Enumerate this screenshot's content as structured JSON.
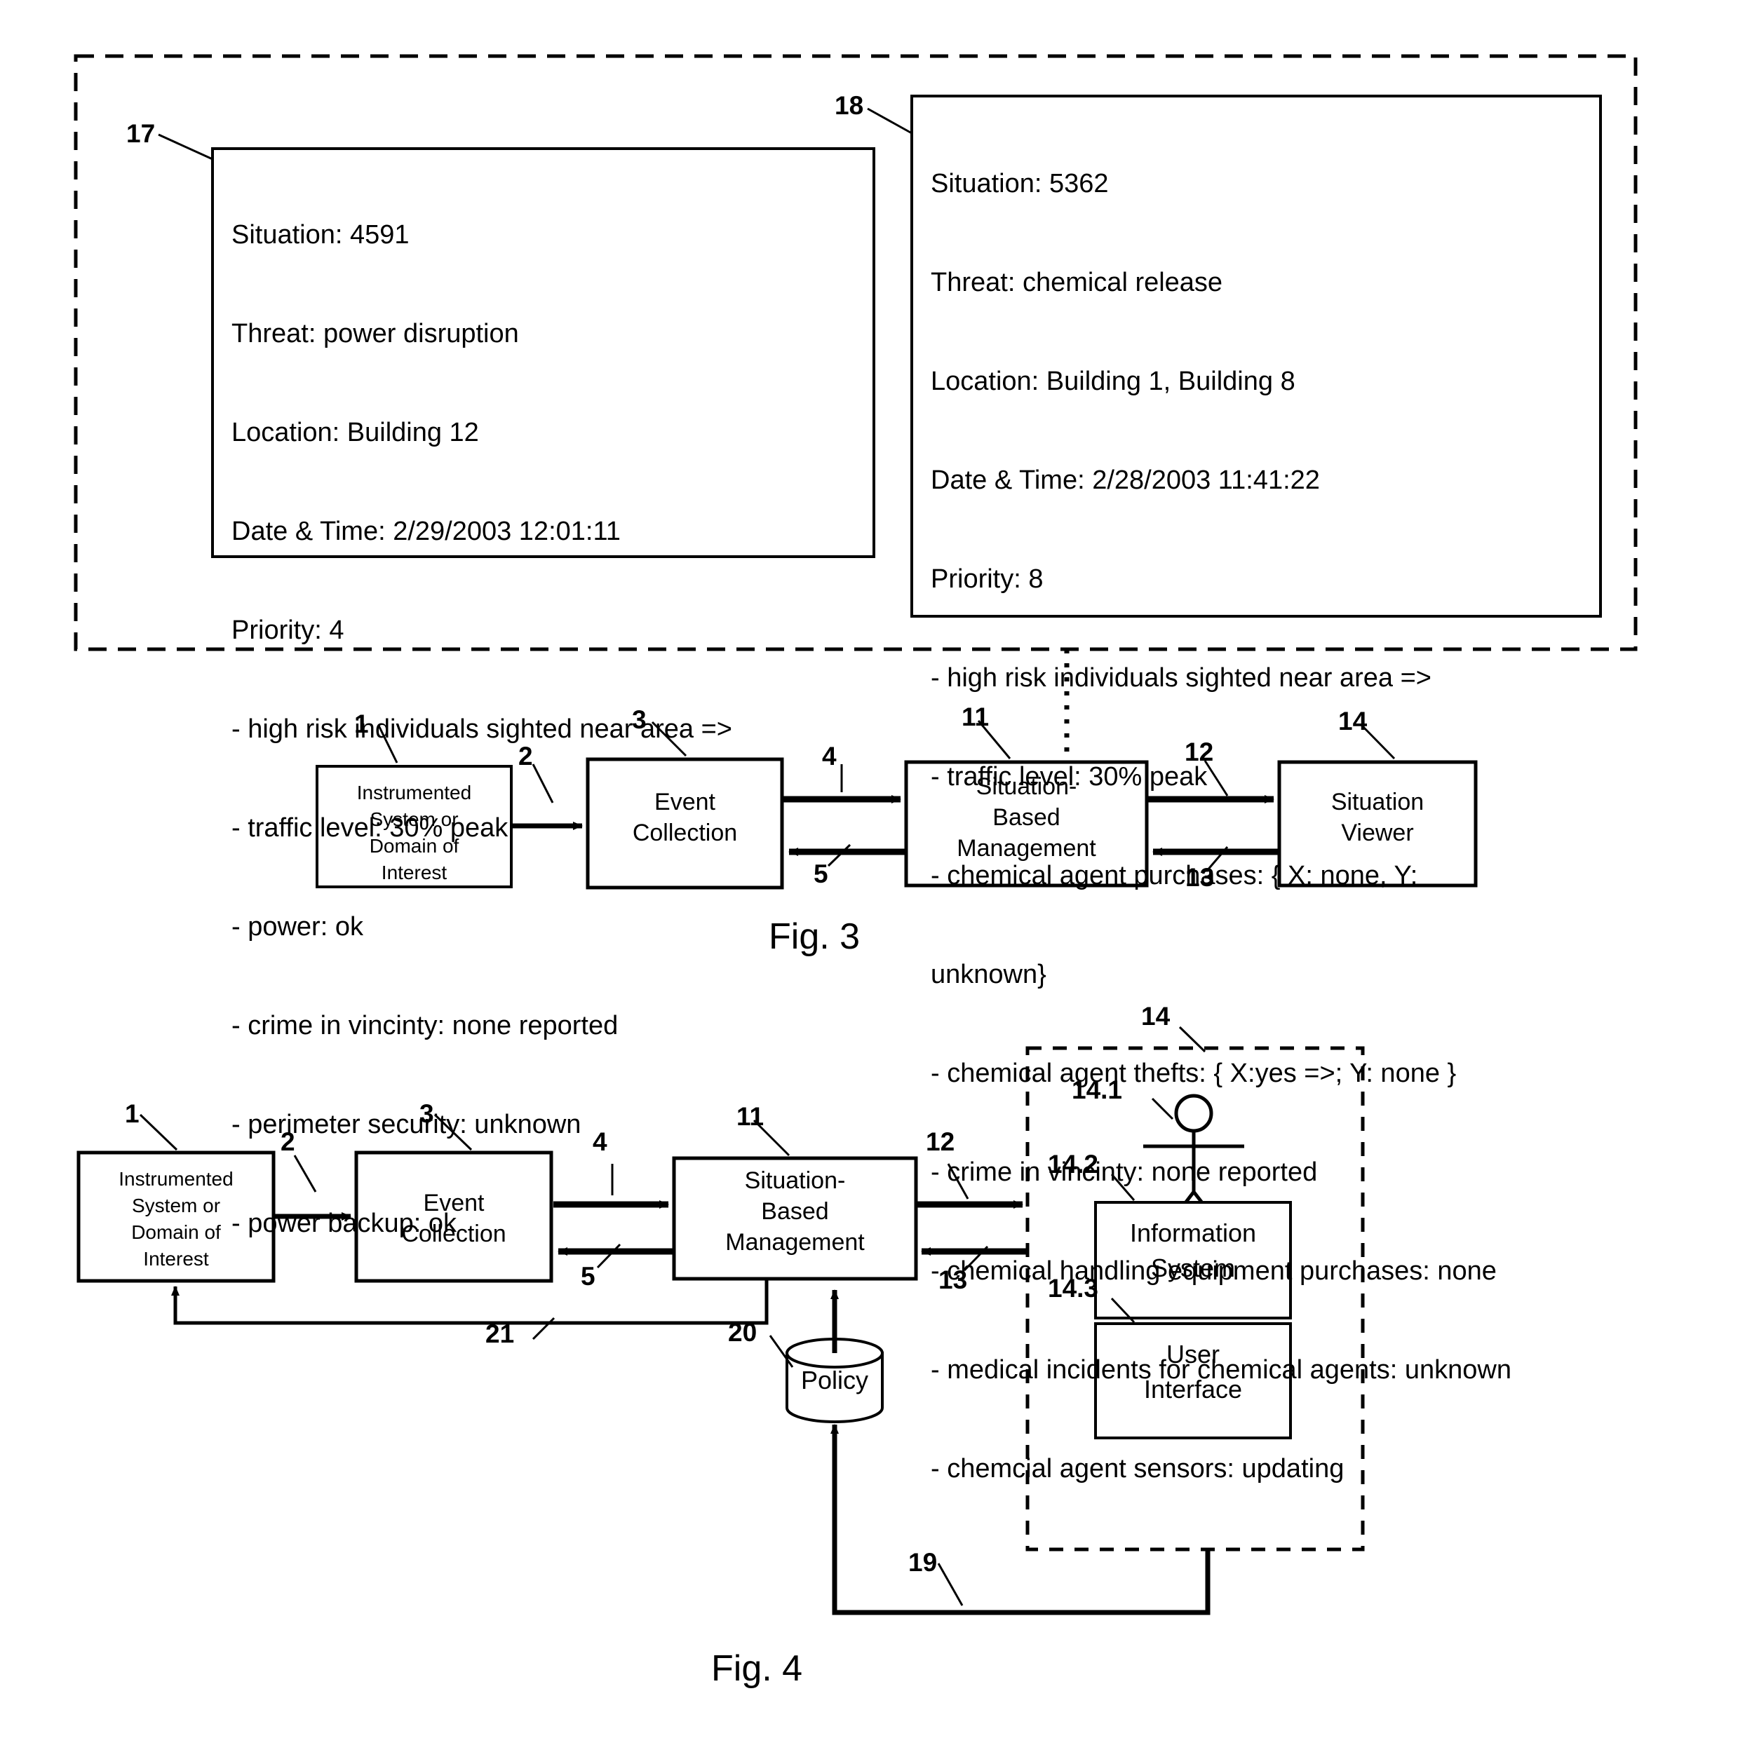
{
  "figure": {
    "title_fig3": "Fig. 3",
    "title_fig4": "Fig. 4"
  },
  "situation_panel": {
    "ref_17": "17",
    "ref_18": "18",
    "situation_17": {
      "lines": [
        "Situation: 4591",
        "Threat: power disruption",
        "Location: Building 12",
        "Date & Time: 2/29/2003 12:01:11",
        "Priority: 4",
        "- high risk individuals sighted near area =>",
        "- traffic level: 30% peak",
        "- power: ok",
        "- crime in vincinty: none reported",
        "- perimeter security: unknown",
        "- power backup: ok"
      ]
    },
    "situation_18": {
      "lines": [
        "Situation: 5362",
        "Threat: chemical release",
        "Location: Building 1, Building 8",
        "Date & Time: 2/28/2003 11:41:22",
        "Priority: 8",
        "- high risk individuals sighted near area =>",
        "- traffic level: 30% peak",
        "- chemical agent purchases: { X: none, Y:",
        "unknown}",
        "- chemical agent thefts: { X:yes =>; Y: none }",
        "- crime in vincinty: none reported",
        "- chemical handling equipment purchases: none",
        "- medical incidents for chemical agents: unknown",
        "- chemcial agent sensors: updating"
      ]
    }
  },
  "fig3": {
    "caption": "Fig. 3",
    "nodes": [
      {
        "ref": "1",
        "label": "Instrumented\nSystem or\nDomain of\nInterest"
      },
      {
        "ref": "3",
        "label": "Event\nCollection"
      },
      {
        "ref": "11",
        "label": "Situation-\nBased\nManagement"
      },
      {
        "ref": "14",
        "label": "Situation\nViewer"
      }
    ],
    "edges": [
      {
        "ref": "2",
        "from": "1",
        "to": "3",
        "direction": "right"
      },
      {
        "ref": "4",
        "from": "3",
        "to": "11",
        "direction": "right"
      },
      {
        "ref": "5",
        "from": "11",
        "to": "3",
        "direction": "left"
      },
      {
        "ref": "12",
        "from": "11",
        "to": "14",
        "direction": "right"
      },
      {
        "ref": "13",
        "from": "14",
        "to": "11",
        "direction": "left"
      }
    ]
  },
  "fig4": {
    "caption": "Fig. 4",
    "nodes": [
      {
        "ref": "1",
        "label": "Instrumented\nSystem or\nDomain of\nInterest"
      },
      {
        "ref": "3",
        "label": "Event\nCollection"
      },
      {
        "ref": "11",
        "label": "Situation-\nBased\nManagement"
      },
      {
        "ref": "20",
        "label": "Policy"
      },
      {
        "ref": "14.2",
        "label": "Information\nSystem"
      },
      {
        "ref": "14.3",
        "label": "User\nInterface"
      }
    ],
    "group": {
      "ref": "14",
      "actor_ref": "14.1"
    },
    "edges": [
      {
        "ref": "2",
        "direction": "right"
      },
      {
        "ref": "4",
        "direction": "right"
      },
      {
        "ref": "5",
        "direction": "left"
      },
      {
        "ref": "12",
        "direction": "right"
      },
      {
        "ref": "13",
        "direction": "left"
      },
      {
        "ref": "19",
        "direction": "feedback"
      },
      {
        "ref": "21",
        "direction": "feedback"
      }
    ]
  },
  "colors": {
    "stroke": "#000000",
    "background": "#ffffff"
  }
}
